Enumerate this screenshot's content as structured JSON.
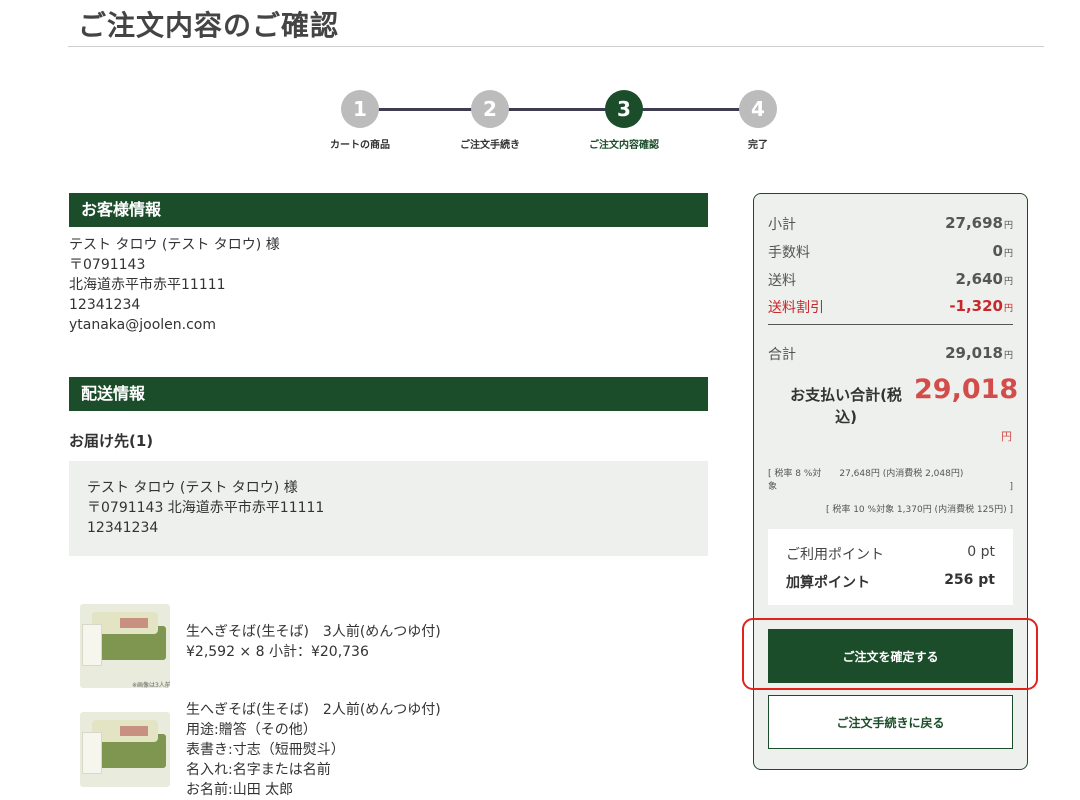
{
  "page_title": "ご注文内容のご確認",
  "stepper": {
    "steps": [
      {
        "number": "1",
        "label": "カートの商品"
      },
      {
        "number": "2",
        "label": "ご注文手続き"
      },
      {
        "number": "3",
        "label": "ご注文内容確認"
      },
      {
        "number": "4",
        "label": "完了"
      }
    ],
    "active_step": 3
  },
  "customer": {
    "section_title": "お客様情報",
    "lines": [
      "テスト タロウ (テスト タロウ) 様",
      "〒0791143",
      "北海道赤平市赤平11111",
      "12341234",
      "ytanaka@joolen.com"
    ]
  },
  "shipping": {
    "section_title": "配送情報",
    "destination_heading": "お届け先(1)",
    "destination_lines": [
      "テスト タロウ (テスト タロウ) 様",
      "〒0791143 北海道赤平市赤平11111",
      "12341234"
    ]
  },
  "products": [
    {
      "image_caption": "※画像は3人前です",
      "lines": [
        "生へぎそば(生そば)　3人前(めんつゆ付)",
        "¥2,592 × 8  小計：¥20,736"
      ]
    },
    {
      "lines": [
        "生へぎそば(生そば)　2人前(めんつゆ付)",
        "用途:贈答（その他）",
        "表書き:寸志（短冊熨斗）",
        "名入れ:名字または名前",
        "お名前:山田 太郎"
      ]
    }
  ],
  "summary": {
    "rows": [
      {
        "label": "小計",
        "amount": "27,698",
        "unit": "円"
      },
      {
        "label": "手数料",
        "amount": "0",
        "unit": "円"
      },
      {
        "label": "送料",
        "amount": "2,640",
        "unit": "円"
      },
      {
        "label": "送料割引",
        "amount": "-1,320",
        "unit": "円"
      }
    ],
    "total_label": "合計",
    "total_amount": "29,018",
    "total_unit": "円",
    "payment_label": "お支払い合計(税込)",
    "payment_amount": "29,018",
    "payment_unit": "円",
    "tax_8_line1": "[ 税率 8 %対　　27,648円 (内消費税 2,048円)",
    "tax_8_line2_left": "象",
    "tax_8_line2_right": "]",
    "tax_10": "[ 税率 10 %対象  1,370円 (内消費税 125円) ]",
    "points_used_label": "ご利用ポイント",
    "points_used_value": "0 pt",
    "points_earned_label": "加算ポイント",
    "points_earned_value": "256 pt",
    "confirm_button": "ご注文を確定する",
    "back_button": "ご注文手続きに戻る"
  },
  "colors": {
    "brand_green": "#1c4d2a",
    "discount_red": "#c7282b",
    "highlight_red": "#e0241c"
  }
}
